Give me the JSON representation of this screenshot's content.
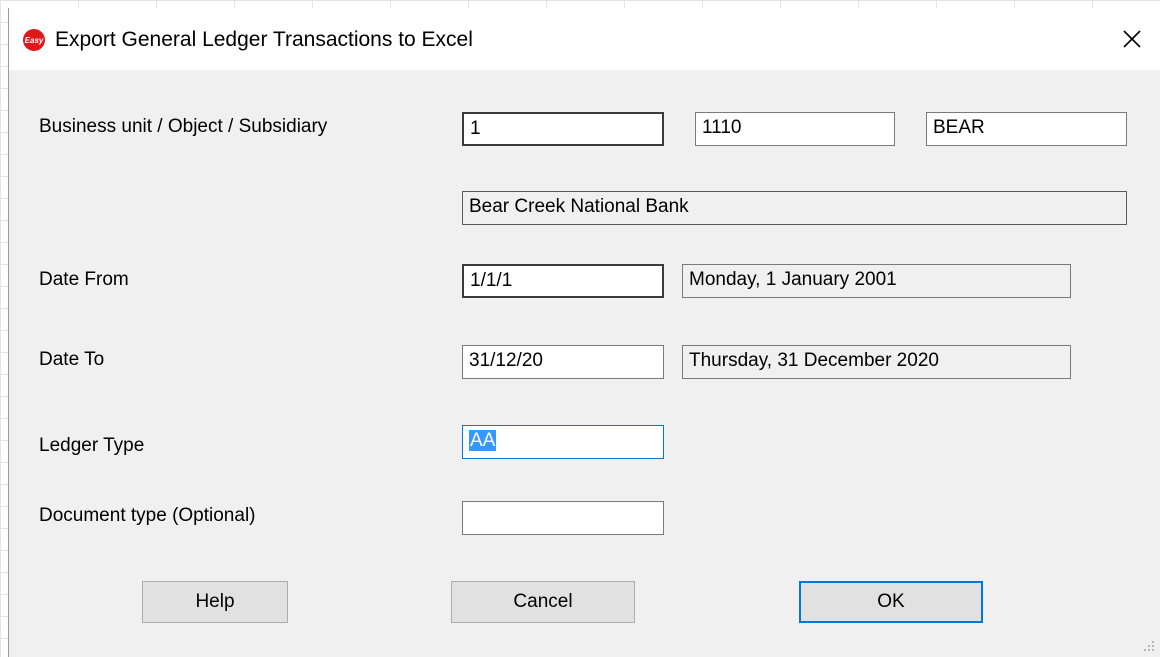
{
  "window": {
    "title": "Export General Ledger Transactions to Excel",
    "app_icon_text": "Easy",
    "close_glyph": "✕"
  },
  "form": {
    "business_unit_label": "Business unit  / Object / Subsidiary",
    "business_unit": "1",
    "object": "1110",
    "subsidiary": "BEAR",
    "account_description": "Bear Creek National Bank",
    "date_from_label": "Date From",
    "date_from": "1/1/1",
    "date_from_long": "Monday, 1 January 2001",
    "date_to_label": "Date To",
    "date_to": "31/12/20",
    "date_to_long": "Thursday, 31 December 2020",
    "ledger_type_label": "Ledger Type",
    "ledger_type": "AA",
    "document_type_label": "Document type (Optional)",
    "document_type": ""
  },
  "buttons": {
    "help": "Help",
    "cancel": "Cancel",
    "ok": "OK"
  },
  "colors": {
    "dialog_bg": "#f0f0f0",
    "accent": "#0078d7",
    "selection": "#3399ff",
    "icon_red": "#e0171b"
  },
  "icons": {
    "app": "easy-logo-icon",
    "close": "close-icon",
    "grip": "resize-grip-icon"
  }
}
